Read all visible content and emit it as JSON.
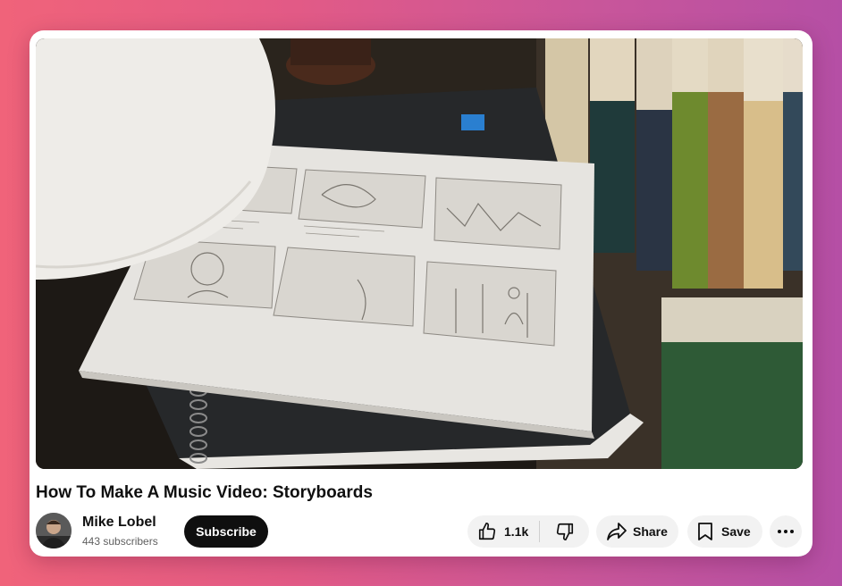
{
  "video": {
    "title": "How To Make A Music Video: Storyboards",
    "thumbnail_subject": "storyboard sketches on drawing pad"
  },
  "channel": {
    "name": "Mike Lobel",
    "subscribers": "443 subscribers"
  },
  "actions": {
    "subscribe_label": "Subscribe",
    "like_count": "1.1k",
    "share_label": "Share",
    "save_label": "Save"
  },
  "colors": {
    "background_start": "#f0637a",
    "background_end": "#b54fa5",
    "subscribe_bg": "#0f0f0f",
    "pill_bg": "#f2f2f2"
  },
  "icons": {
    "like": "thumbs-up-icon",
    "dislike": "thumbs-down-icon",
    "share": "share-arrow-icon",
    "save": "bookmark-icon",
    "more": "more-horizontal-icon"
  }
}
